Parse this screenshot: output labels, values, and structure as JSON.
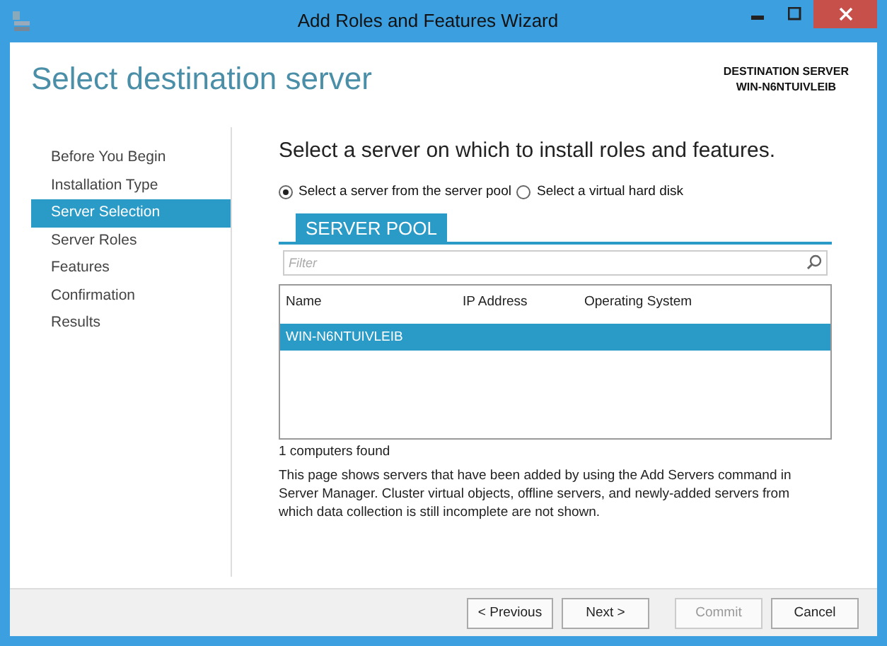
{
  "window": {
    "title": "Add Roles and Features Wizard"
  },
  "header": {
    "title": "Select destination server",
    "destination_label": "DESTINATION SERVER",
    "destination_value": "WIN-N6NTUIVLEIB"
  },
  "steps": [
    {
      "label": "Before You Begin",
      "selected": false
    },
    {
      "label": "Installation Type",
      "selected": false
    },
    {
      "label": "Server Selection",
      "selected": true
    },
    {
      "label": "Server Roles",
      "selected": false
    },
    {
      "label": "Features",
      "selected": false
    },
    {
      "label": "Confirmation",
      "selected": false
    },
    {
      "label": "Results",
      "selected": false
    }
  ],
  "heading": "Select a server on which to install roles and features.",
  "options": [
    {
      "label": "Select a server from the server pool",
      "selected": true
    },
    {
      "label": "Select a virtual hard disk",
      "selected": false
    }
  ],
  "server_pool": {
    "title": "SERVER POOL",
    "filter": {
      "placeholder": "Filter"
    },
    "columns": [
      "Name",
      "IP Address",
      "Operating System"
    ],
    "rows": [
      {
        "cells": [
          "WIN-N6NTUIVLEIB"
        ],
        "selected": true
      }
    ]
  },
  "count": "1 computers found",
  "description": "This page shows servers that have been added by using the Add Servers command in Server Manager.  Cluster virtual objects, offline servers, and newly-added servers from which data collection is still incomplete are not shown.",
  "buttons": [
    {
      "label": "< Previous",
      "disabled": false
    },
    {
      "label": "Next >",
      "disabled": false
    },
    {
      "label": "Commit",
      "disabled": true
    },
    {
      "label": "Cancel",
      "disabled": false
    }
  ]
}
